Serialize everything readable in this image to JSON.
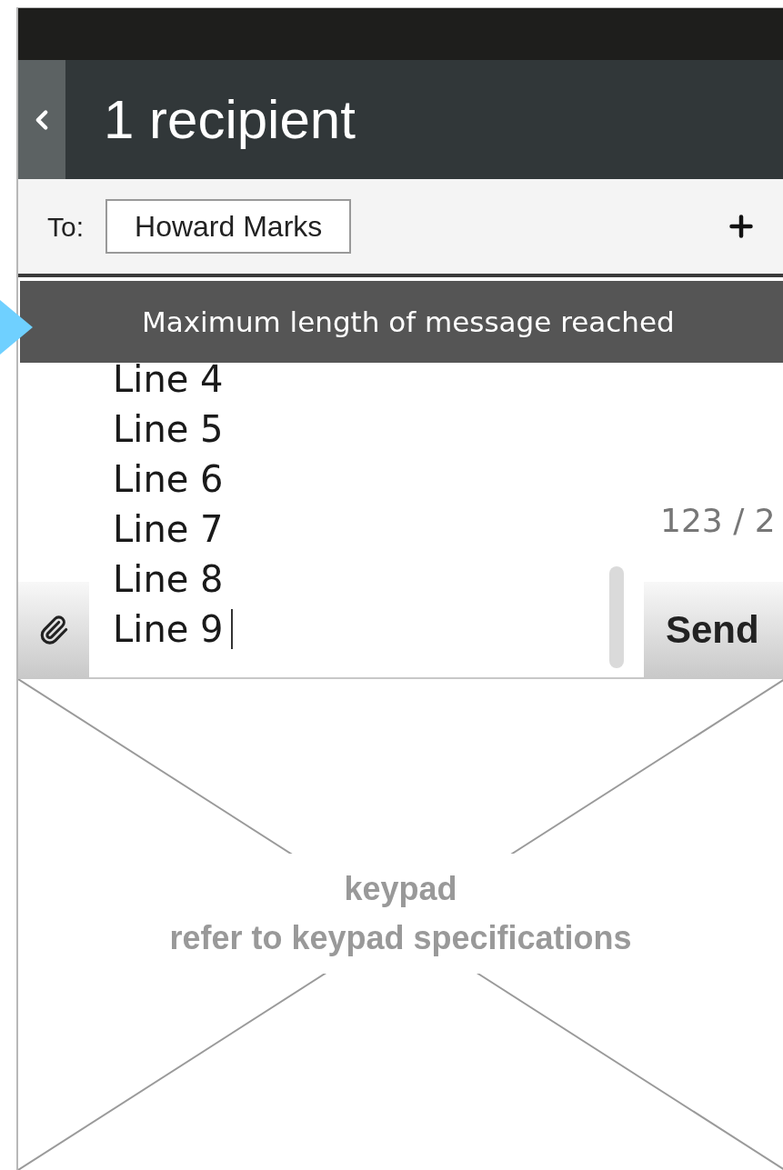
{
  "header": {
    "title": "1 recipient"
  },
  "recipients": {
    "label": "To:",
    "chips": [
      "Howard Marks"
    ]
  },
  "toast": {
    "text": "Maximum length of message reached"
  },
  "message": {
    "lines": [
      "Line 4",
      "Line 5",
      "Line 6",
      "Line 7",
      "Line 8",
      "Line 9"
    ],
    "counter": "123 / 2"
  },
  "send_button": "Send",
  "keypad": {
    "title": "keypad",
    "subtitle": "refer to keypad specifications"
  }
}
